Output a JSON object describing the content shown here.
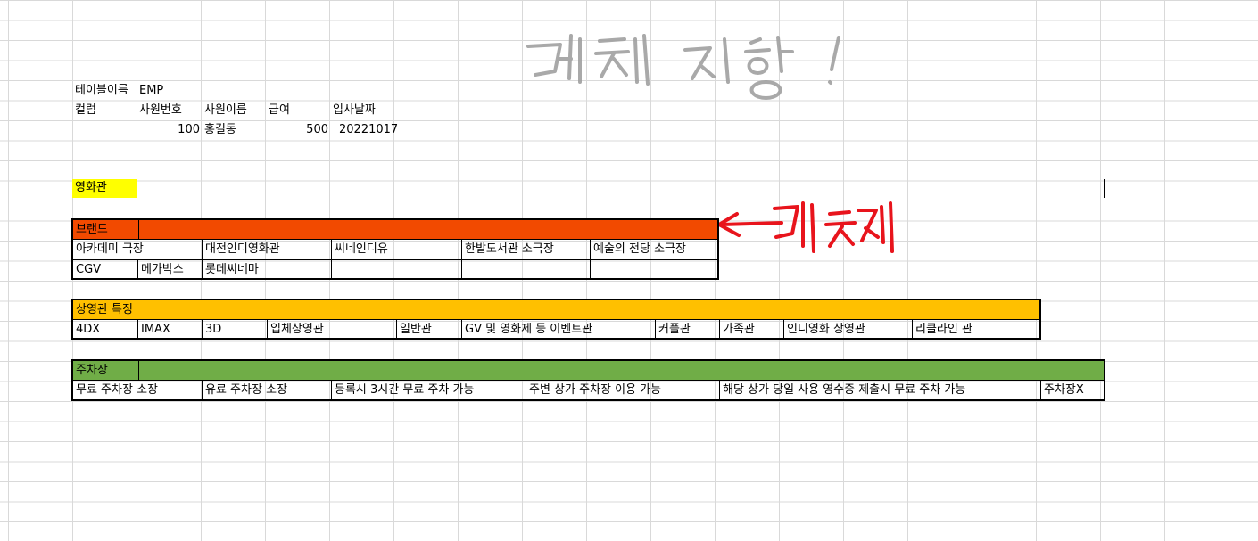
{
  "table_info": {
    "table_label": "테이블이름",
    "table_name": "EMP",
    "column_label": "컬럼",
    "headers": [
      "사원번호",
      "사원이름",
      "급여",
      "입사날짜"
    ],
    "row": {
      "emp_no": "100",
      "name": "홍길동",
      "salary": "500",
      "hire_date": "20221017"
    }
  },
  "section_title": "영화관",
  "brand": {
    "title": "브랜드",
    "row1": [
      "아카데미 극장",
      "대전인디영화관",
      "씨네인디유",
      "한밭도서관 소극장",
      "예술의 전당 소극장"
    ],
    "row2": [
      "CGV",
      "메가박스",
      "롯데씨네마",
      "",
      ""
    ]
  },
  "features": {
    "title": "상영관 특징",
    "items": [
      "4DX",
      "IMAX",
      "3D",
      "입체상영관",
      "일반관",
      "GV 및 영화제 등 이벤트관",
      "커플관",
      "가족관",
      "인디영화 상영관",
      "리클라인 관"
    ]
  },
  "parking": {
    "title": "주차장",
    "items": [
      "무료 주차장 소장",
      "유료 주차장 소장",
      "등록시 3시간 무료 주차 가능",
      "주변 상가 주차장 이용 가능",
      "해당 상가 당일 사용 영수증 제출시 무료 주차 가능",
      "주차장X"
    ]
  },
  "colors": {
    "brand_bar": "#f24a00",
    "features_bar": "#ffc000",
    "parking_bar": "#70ad47",
    "highlight": "#ffff00",
    "annotation_red": "#e8141c",
    "handwriting_gray": "#9a9a9a"
  },
  "annotations": {
    "handwritten_gray": "handwritten-heading",
    "handwritten_red": "handwritten-note-with-arrow"
  }
}
